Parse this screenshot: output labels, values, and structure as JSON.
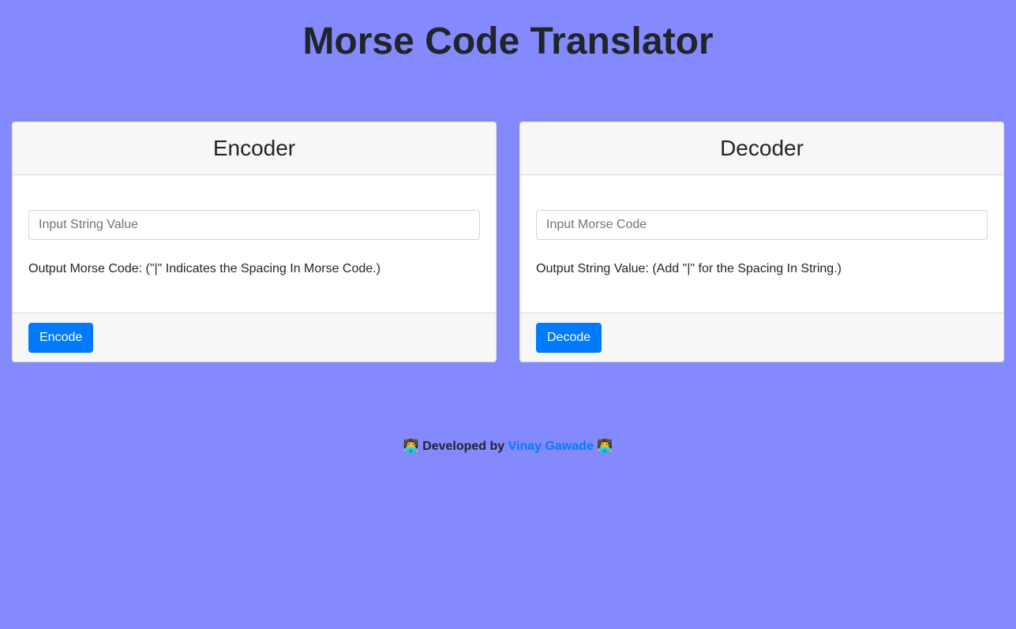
{
  "page": {
    "title": "Morse Code Translator"
  },
  "encoder": {
    "header": "Encoder",
    "input_placeholder": "Input String Value",
    "input_value": "",
    "output_label": "Output Morse Code: (\"|\" Indicates the Spacing In Morse Code.)",
    "button_label": "Encode"
  },
  "decoder": {
    "header": "Decoder",
    "input_placeholder": "Input Morse Code",
    "input_value": "",
    "output_label": "Output String Value: (Add \"|\" for the Spacing In String.)",
    "button_label": "Decode"
  },
  "footer": {
    "emoji": "👨‍💻",
    "prefix": "Developed by",
    "author_link": "Vinay Gawade"
  },
  "colors": {
    "background": "#8589fe",
    "primary": "#007bff"
  }
}
